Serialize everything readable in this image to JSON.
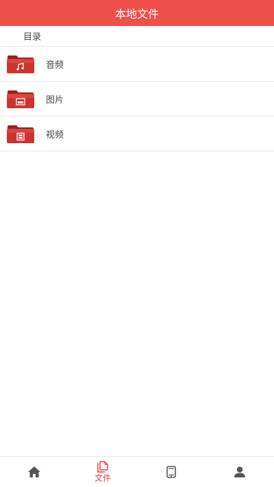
{
  "header": {
    "title": "本地文件"
  },
  "breadcrumb": {
    "label": "目录"
  },
  "folders": [
    {
      "label": "音频",
      "icon": "music-folder-icon"
    },
    {
      "label": "图片",
      "icon": "image-folder-icon"
    },
    {
      "label": "视频",
      "icon": "video-folder-icon"
    }
  ],
  "tabbar": {
    "tabs": [
      {
        "icon": "home-icon",
        "label": ""
      },
      {
        "icon": "files-icon",
        "label": "文件",
        "active": true
      },
      {
        "icon": "device-icon",
        "label": ""
      },
      {
        "icon": "user-icon",
        "label": ""
      }
    ]
  },
  "colors": {
    "accent": "#ee504c",
    "folder": "#c8302c",
    "inactive_icon": "#555555",
    "active_tab": "#e2433d"
  }
}
